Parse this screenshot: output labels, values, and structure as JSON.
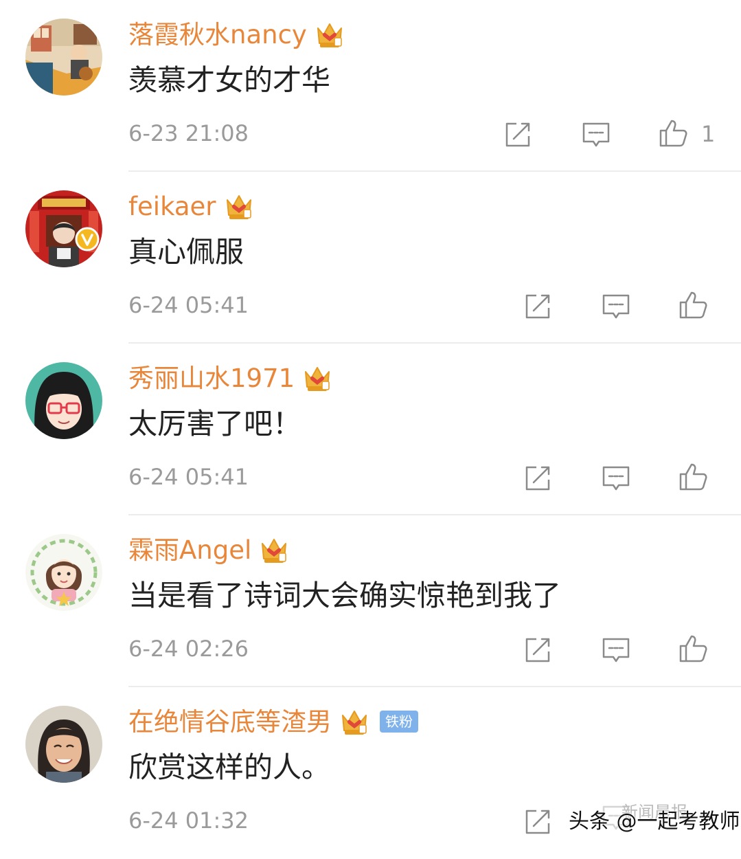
{
  "comments": [
    {
      "username": "落霞秋水nancy",
      "content": "羡慕才女的才华",
      "time": "6-23 21:08",
      "like_count": "1",
      "badges": [
        "crown-badge"
      ]
    },
    {
      "username": "feikaer",
      "content": "真心佩服",
      "time": "6-24 05:41",
      "like_count": "",
      "badges": [
        "crown-badge",
        "verified-badge"
      ]
    },
    {
      "username": "秀丽山水1971",
      "content": "太厉害了吧！",
      "time": "6-24 05:41",
      "like_count": "",
      "badges": [
        "crown-badge"
      ]
    },
    {
      "username": "霖雨Angel",
      "content": "当是看了诗词大会确实惊艳到我了",
      "time": "6-24 02:26",
      "like_count": "",
      "badges": [
        "crown-badge"
      ]
    },
    {
      "username": "在绝情谷底等渣男",
      "content": "欣赏这样的人。",
      "time": "6-24 01:32",
      "like_count": "",
      "badges": [
        "crown-badge"
      ],
      "fan_badge": "铁粉"
    }
  ],
  "actions": {
    "icons": [
      "forward-icon",
      "comment-icon",
      "like-icon"
    ]
  },
  "watermark": {
    "main": "头条 @一起考教师",
    "faded": "新闻晨报"
  },
  "colors": {
    "username": "#e8863a",
    "content": "#222222",
    "meta": "#9a9a9a",
    "icon": "#8a8a8a",
    "crown": "#f0b43c",
    "fan_badge": "#7fb1ea",
    "divider": "#ececec"
  }
}
